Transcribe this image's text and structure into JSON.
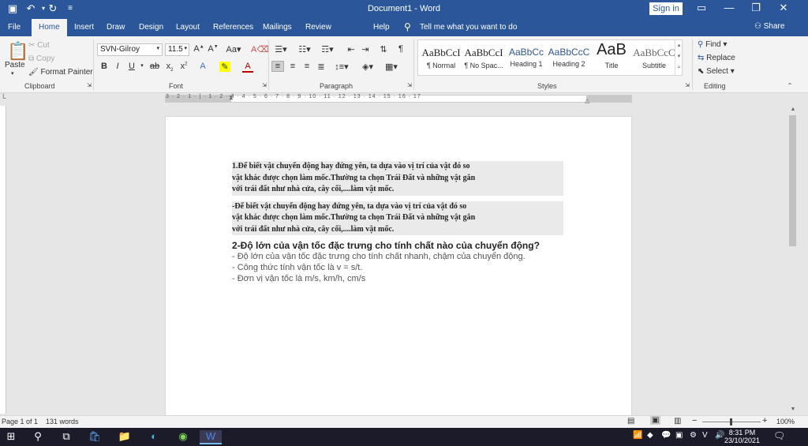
{
  "app": {
    "title": "Document1 - Word",
    "sign_in": "Sign in"
  },
  "tabs": [
    {
      "label": "File"
    },
    {
      "label": "Home"
    },
    {
      "label": "Insert"
    },
    {
      "label": "Draw"
    },
    {
      "label": "Design"
    },
    {
      "label": "Layout"
    },
    {
      "label": "References"
    },
    {
      "label": "Mailings"
    },
    {
      "label": "Review"
    },
    {
      "label": "Help"
    }
  ],
  "tell_me": "Tell me what you want to do",
  "share": "Share",
  "ribbon": {
    "clipboard": {
      "label": "Clipboard",
      "paste": "Paste",
      "cut": "Cut",
      "copy": "Copy",
      "format_painter": "Format Painter"
    },
    "font": {
      "label": "Font",
      "name": "SVN-Gilroy",
      "size": "11.5"
    },
    "paragraph": {
      "label": "Paragraph"
    },
    "styles": {
      "label": "Styles",
      "items": [
        {
          "sample": "AaBbCcI",
          "name": "¶ Normal"
        },
        {
          "sample": "AaBbCcI",
          "name": "¶ No Spac..."
        },
        {
          "sample": "AaBbCc",
          "name": "Heading 1"
        },
        {
          "sample": "AaBbCcC",
          "name": "Heading 2"
        },
        {
          "sample": "AaB",
          "name": "Title"
        },
        {
          "sample": "AaBbCcC",
          "name": "Subtitle"
        }
      ]
    },
    "editing": {
      "label": "Editing",
      "find": "Find",
      "replace": "Replace",
      "select": "Select"
    }
  },
  "ruler": {
    "numbers": "3 · 2 · 1 · | · 1 · 2 · 3 · 4 · 5 · 6 · 7 · 8 · 9 · 10 · 11 · 12 · 13 · 14 · 15 · 16 · 17"
  },
  "document": {
    "para1": [
      "1.Để biết vật chuyển động hay đứng yên, ta dựa vào vị trí của vật đó so",
      "vật khác được chọn làm mốc.Thường ta chọn Trái Đất và những vật gắn",
      "với trái đất như nhà cửa, cây cối,....làm vật mốc."
    ],
    "para2": [
      "-Để biết vật chuyển động hay đứng yên, ta dựa vào vị trí của vật đó so",
      "vật khác được chọn làm mốc.Thường ta chọn Trái Đất và những vật gắn",
      "với trái đất như nhà cửa, cây cối,....làm vật mốc."
    ],
    "q2_title": "2-Độ lớn của vận tốc đặc trưng cho tính chất nào của chuyển động?",
    "q2_answers": [
      "- Độ lớn của vận tốc đặc trưng cho tính chất nhanh, chậm của chuyển động.",
      "- Công thức tính vận tốc là v = s/t.",
      "- Đơn vị vận tốc là m/s, km/h, cm/s"
    ]
  },
  "status": {
    "page": "Page 1 of 1",
    "words": "131 words",
    "zoom": "100%"
  },
  "taskbar": {
    "time": "8:31 PM",
    "date": "23/10/2021"
  }
}
